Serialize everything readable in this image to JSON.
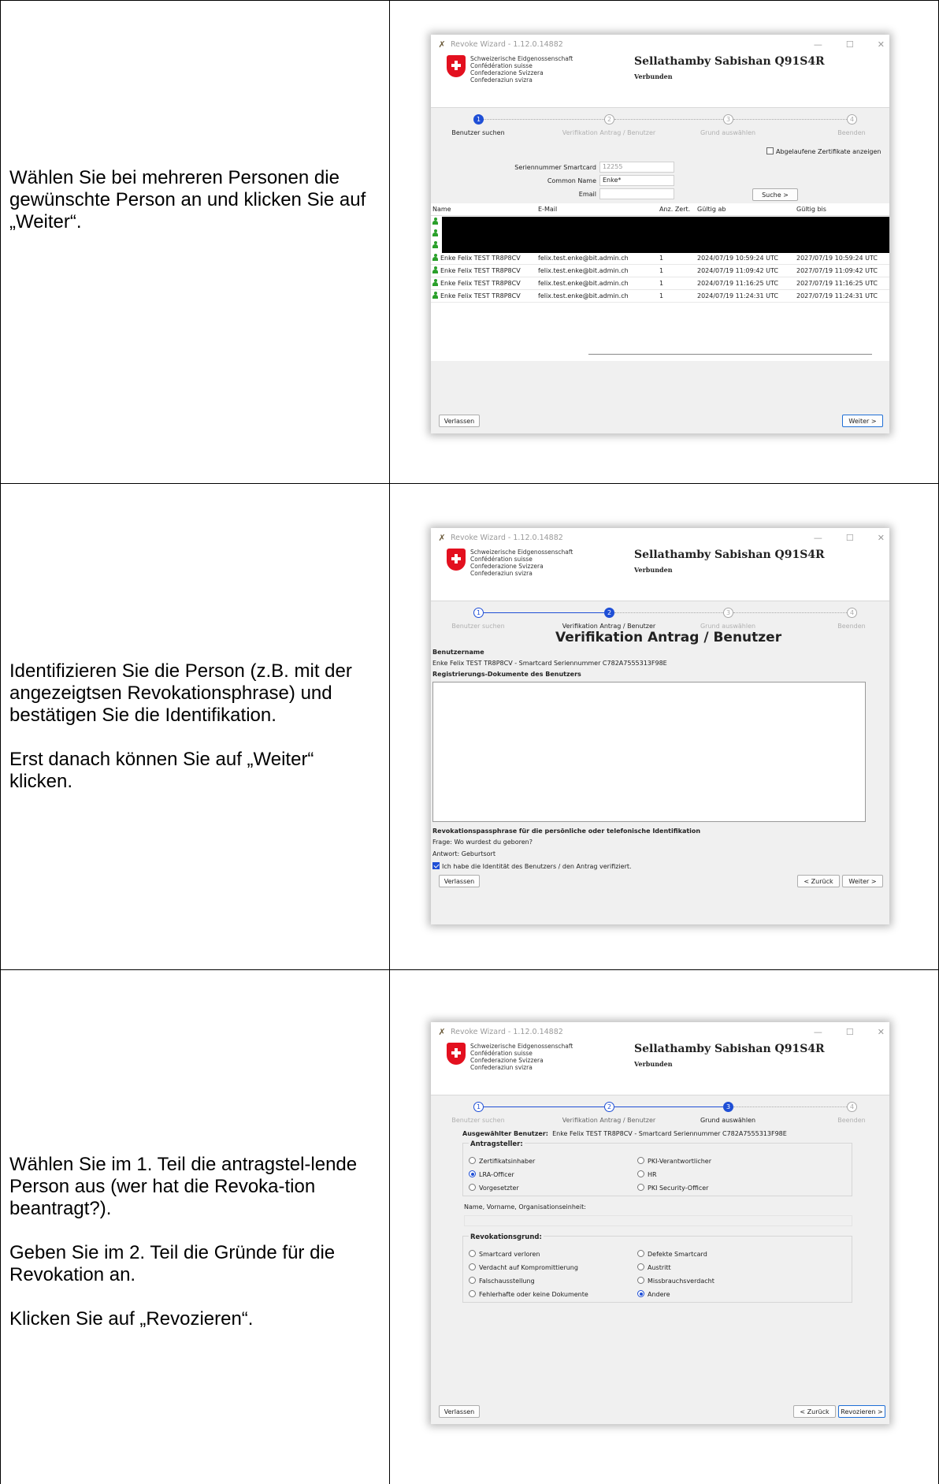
{
  "rows": [
    {
      "instructions": [
        "Wählen Sie bei mehreren Personen die gewünschte Person an und klicken Sie auf „Weiter“."
      ]
    },
    {
      "instructions": [
        "Identifizieren Sie die Person (z.B. mit der angezeigtsen Revokationsphrase) und bestätigen Sie die Identifikation.",
        "Erst danach können Sie auf „Weiter“ klicken."
      ]
    },
    {
      "instructions": [
        "Wählen Sie im 1. Teil die antragstel-lende Person aus (wer hat die Revoka-tion beantragt?).",
        "Geben Sie im 2. Teil die Gründe für die Revokation an.",
        "Klicken Sie auf „Revozieren“."
      ]
    }
  ],
  "window": {
    "title": "Revoke Wizard - 1.12.0.14882",
    "controls": [
      "—",
      "☐",
      "✕"
    ],
    "confederation": [
      "Schweizerische Eidgenossenschaft",
      "Confédération suisse",
      "Confederazione Svizzera",
      "Confederaziun svizra"
    ],
    "user": "Sellathamby Sabishan Q91S4R",
    "status": "Verbunden",
    "steps": [
      "Benutzer suchen",
      "Verifikation Antrag / Benutzer",
      "Grund auswählen",
      "Beenden"
    ],
    "step_numbers": [
      "1",
      "2",
      "3",
      "4"
    ],
    "leave_label": "Verlassen",
    "next_label": "Weiter >",
    "back_label": "< Zurück",
    "revoke_label": "Revozieren >"
  },
  "search": {
    "show_expired_label": "Abgelaufene Zertifikate anzeigen",
    "serial_label": "Seriennummer Smartcard",
    "serial_value": "12255",
    "common_name_label": "Common Name",
    "common_name_value": "Enke*",
    "email_label": "Email",
    "email_value": "",
    "search_button": "Suche >",
    "columns": [
      "Name",
      "E-Mail",
      "Anz. Zert.",
      "Gültig ab",
      "Gültig bis"
    ],
    "rows": [
      [
        "Enke Felix TEST TR8P8CV",
        "felix.test.enke@bit.admin.ch",
        "1",
        "2024/07/19 10:59:24 UTC",
        "2027/07/19 10:59:24 UTC"
      ],
      [
        "Enke Felix TEST TR8P8CV",
        "felix.test.enke@bit.admin.ch",
        "1",
        "2024/07/19 11:09:42 UTC",
        "2027/07/19 11:09:42 UTC"
      ],
      [
        "Enke Felix TEST TR8P8CV",
        "felix.test.enke@bit.admin.ch",
        "1",
        "2024/07/19 11:16:25 UTC",
        "2027/07/19 11:16:25 UTC"
      ],
      [
        "Enke Felix TEST TR8P8CV",
        "felix.test.enke@bit.admin.ch",
        "1",
        "2024/07/19 11:24:31 UTC",
        "2027/07/19 11:24:31 UTC"
      ]
    ]
  },
  "verify": {
    "heading": "Verifikation Antrag / Benutzer",
    "username_label": "Benutzername",
    "username_value": "Enke Felix TEST TR8P8CV - Smartcard Seriennummer C782A7555313F98E",
    "docs_label": "Registrierungs-Dokumente des Benutzers",
    "passphrase_label": "Revokationspassphrase für die persönliche oder telefonische Identifikation",
    "question": "Frage: Wo wurdest du geboren?",
    "answer": "Antwort:   Geburtsort",
    "confirm_label": "Ich habe die Identität des Benutzers / den Antrag verifiziert."
  },
  "reason": {
    "selected_label": "Ausgewählter Benutzer:",
    "selected_value": "Enke Felix TEST TR8P8CV - Smartcard Seriennummer C782A7555313F98E",
    "applicant_title": "Antragsteller:",
    "applicant_options": [
      "Zertifikatsinhaber",
      "PKI-Verantwortlicher",
      "LRA-Officer",
      "HR",
      "Vorgesetzter",
      "PKI Security-Officer"
    ],
    "name_label": "Name, Vorname, Organisationseinheit:",
    "reason_title": "Revokationsgrund:",
    "reason_options": [
      "Smartcard verloren",
      "Defekte Smartcard",
      "Verdacht auf Kompromittierung",
      "Austritt",
      "Falschausstellung",
      "Missbrauchsverdacht",
      "Fehlerhafte oder keine Dokumente",
      "Andere"
    ]
  }
}
